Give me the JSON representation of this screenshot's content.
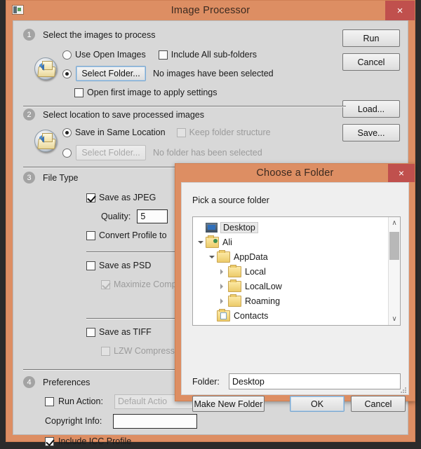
{
  "main_window": {
    "title": "Image Processor",
    "window_icon": "image-processor-icon",
    "close_label": "×",
    "buttons": {
      "run": "Run",
      "cancel": "Cancel",
      "load": "Load...",
      "save": "Save..."
    },
    "sections": [
      {
        "number": "1",
        "title": "Select the images to process",
        "icon": "folder-picture-icon",
        "radio_use_open_images": {
          "label": "Use Open Images",
          "checked": false
        },
        "checkbox_include_subfolders": {
          "label": "Include All sub-folders",
          "checked": false
        },
        "radio_select_folder": {
          "checked": true
        },
        "button_select_folder": "Select Folder...",
        "status": "No images have been selected",
        "checkbox_open_first": {
          "label": "Open first image to apply settings",
          "checked": false
        }
      },
      {
        "number": "2",
        "title": "Select location to save processed images",
        "icon": "folder-picture-icon",
        "radio_save_same_location": {
          "label": "Save in Same Location",
          "checked": true
        },
        "checkbox_keep_folder_structure": {
          "label": "Keep folder structure",
          "checked": false,
          "disabled": true
        },
        "radio_select_folder": {
          "checked": false
        },
        "button_select_folder": "Select Folder...",
        "status": "No folder has been selected"
      },
      {
        "number": "3",
        "title": "File Type",
        "jpeg": {
          "label": "Save as JPEG",
          "checked": true
        },
        "quality_label": "Quality:",
        "quality_value": "5",
        "convert_profile": {
          "label": "Convert Profile to",
          "checked": false
        },
        "psd": {
          "label": "Save as PSD",
          "checked": false
        },
        "maximize_compat": {
          "label": "Maximize Compatib",
          "checked": true,
          "disabled": true
        },
        "tiff": {
          "label": "Save as TIFF",
          "checked": false
        },
        "lzw": {
          "label": "LZW Compression",
          "checked": false,
          "disabled": true
        }
      },
      {
        "number": "4",
        "title": "Preferences",
        "run_action": {
          "label": "Run Action:",
          "checked": false
        },
        "action_value": "Default Actio",
        "copyright_label": "Copyright Info:",
        "copyright_value": "",
        "icc": {
          "label": "Include ICC Profile",
          "checked": true
        }
      }
    ]
  },
  "folder_dialog": {
    "title": "Choose a Folder",
    "close_label": "×",
    "prompt": "Pick a source folder",
    "tree": [
      {
        "label": "Desktop",
        "indent": 0,
        "twisty": "none",
        "icon": "desktop-icon",
        "selected": true
      },
      {
        "label": "Ali",
        "indent": 0,
        "twisty": "expanded",
        "icon": "user-folder-icon",
        "selected": false
      },
      {
        "label": "AppData",
        "indent": 1,
        "twisty": "expanded",
        "icon": "folder-icon",
        "selected": false
      },
      {
        "label": "Local",
        "indent": 2,
        "twisty": "collapsed",
        "icon": "folder-icon",
        "selected": false
      },
      {
        "label": "LocalLow",
        "indent": 2,
        "twisty": "collapsed",
        "icon": "folder-icon",
        "selected": false
      },
      {
        "label": "Roaming",
        "indent": 2,
        "twisty": "collapsed",
        "icon": "folder-icon",
        "selected": false
      },
      {
        "label": "Contacts",
        "indent": 1,
        "twisty": "none",
        "icon": "contacts-icon",
        "selected": false
      }
    ],
    "folder_label": "Folder:",
    "folder_value": "Desktop",
    "buttons": {
      "make_new_folder": "Make New Folder",
      "ok": "OK",
      "cancel": "Cancel"
    },
    "scroll_up_glyph": "∧",
    "scroll_down_glyph": "∨"
  },
  "colors": {
    "titlebar": "#dd8e63",
    "close_button": "#c0504d",
    "dialog_face": "#d8d8d8",
    "folder_dialog_face": "#efefef",
    "focus_ring": "#7aa8d0"
  }
}
